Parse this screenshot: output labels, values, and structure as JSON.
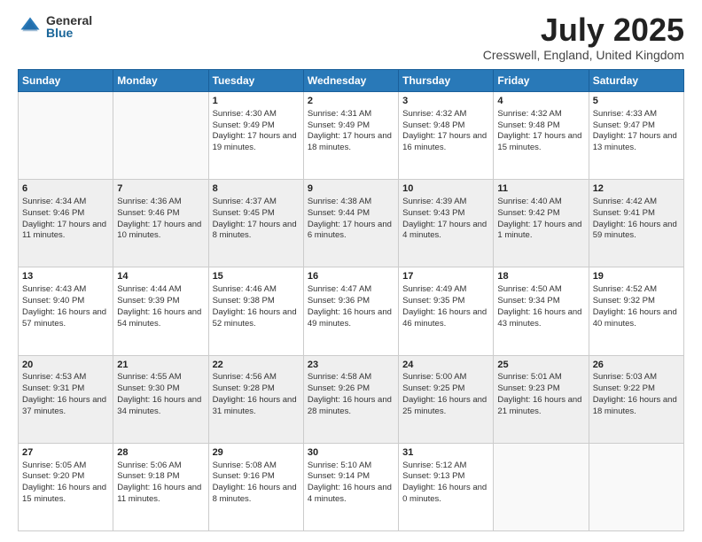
{
  "header": {
    "logo_general": "General",
    "logo_blue": "Blue",
    "title": "July 2025",
    "location": "Cresswell, England, United Kingdom"
  },
  "weekdays": [
    "Sunday",
    "Monday",
    "Tuesday",
    "Wednesday",
    "Thursday",
    "Friday",
    "Saturday"
  ],
  "weeks": [
    [
      {
        "day": "",
        "info": ""
      },
      {
        "day": "",
        "info": ""
      },
      {
        "day": "1",
        "info": "Sunrise: 4:30 AM\nSunset: 9:49 PM\nDaylight: 17 hours and 19 minutes."
      },
      {
        "day": "2",
        "info": "Sunrise: 4:31 AM\nSunset: 9:49 PM\nDaylight: 17 hours and 18 minutes."
      },
      {
        "day": "3",
        "info": "Sunrise: 4:32 AM\nSunset: 9:48 PM\nDaylight: 17 hours and 16 minutes."
      },
      {
        "day": "4",
        "info": "Sunrise: 4:32 AM\nSunset: 9:48 PM\nDaylight: 17 hours and 15 minutes."
      },
      {
        "day": "5",
        "info": "Sunrise: 4:33 AM\nSunset: 9:47 PM\nDaylight: 17 hours and 13 minutes."
      }
    ],
    [
      {
        "day": "6",
        "info": "Sunrise: 4:34 AM\nSunset: 9:46 PM\nDaylight: 17 hours and 11 minutes."
      },
      {
        "day": "7",
        "info": "Sunrise: 4:36 AM\nSunset: 9:46 PM\nDaylight: 17 hours and 10 minutes."
      },
      {
        "day": "8",
        "info": "Sunrise: 4:37 AM\nSunset: 9:45 PM\nDaylight: 17 hours and 8 minutes."
      },
      {
        "day": "9",
        "info": "Sunrise: 4:38 AM\nSunset: 9:44 PM\nDaylight: 17 hours and 6 minutes."
      },
      {
        "day": "10",
        "info": "Sunrise: 4:39 AM\nSunset: 9:43 PM\nDaylight: 17 hours and 4 minutes."
      },
      {
        "day": "11",
        "info": "Sunrise: 4:40 AM\nSunset: 9:42 PM\nDaylight: 17 hours and 1 minute."
      },
      {
        "day": "12",
        "info": "Sunrise: 4:42 AM\nSunset: 9:41 PM\nDaylight: 16 hours and 59 minutes."
      }
    ],
    [
      {
        "day": "13",
        "info": "Sunrise: 4:43 AM\nSunset: 9:40 PM\nDaylight: 16 hours and 57 minutes."
      },
      {
        "day": "14",
        "info": "Sunrise: 4:44 AM\nSunset: 9:39 PM\nDaylight: 16 hours and 54 minutes."
      },
      {
        "day": "15",
        "info": "Sunrise: 4:46 AM\nSunset: 9:38 PM\nDaylight: 16 hours and 52 minutes."
      },
      {
        "day": "16",
        "info": "Sunrise: 4:47 AM\nSunset: 9:36 PM\nDaylight: 16 hours and 49 minutes."
      },
      {
        "day": "17",
        "info": "Sunrise: 4:49 AM\nSunset: 9:35 PM\nDaylight: 16 hours and 46 minutes."
      },
      {
        "day": "18",
        "info": "Sunrise: 4:50 AM\nSunset: 9:34 PM\nDaylight: 16 hours and 43 minutes."
      },
      {
        "day": "19",
        "info": "Sunrise: 4:52 AM\nSunset: 9:32 PM\nDaylight: 16 hours and 40 minutes."
      }
    ],
    [
      {
        "day": "20",
        "info": "Sunrise: 4:53 AM\nSunset: 9:31 PM\nDaylight: 16 hours and 37 minutes."
      },
      {
        "day": "21",
        "info": "Sunrise: 4:55 AM\nSunset: 9:30 PM\nDaylight: 16 hours and 34 minutes."
      },
      {
        "day": "22",
        "info": "Sunrise: 4:56 AM\nSunset: 9:28 PM\nDaylight: 16 hours and 31 minutes."
      },
      {
        "day": "23",
        "info": "Sunrise: 4:58 AM\nSunset: 9:26 PM\nDaylight: 16 hours and 28 minutes."
      },
      {
        "day": "24",
        "info": "Sunrise: 5:00 AM\nSunset: 9:25 PM\nDaylight: 16 hours and 25 minutes."
      },
      {
        "day": "25",
        "info": "Sunrise: 5:01 AM\nSunset: 9:23 PM\nDaylight: 16 hours and 21 minutes."
      },
      {
        "day": "26",
        "info": "Sunrise: 5:03 AM\nSunset: 9:22 PM\nDaylight: 16 hours and 18 minutes."
      }
    ],
    [
      {
        "day": "27",
        "info": "Sunrise: 5:05 AM\nSunset: 9:20 PM\nDaylight: 16 hours and 15 minutes."
      },
      {
        "day": "28",
        "info": "Sunrise: 5:06 AM\nSunset: 9:18 PM\nDaylight: 16 hours and 11 minutes."
      },
      {
        "day": "29",
        "info": "Sunrise: 5:08 AM\nSunset: 9:16 PM\nDaylight: 16 hours and 8 minutes."
      },
      {
        "day": "30",
        "info": "Sunrise: 5:10 AM\nSunset: 9:14 PM\nDaylight: 16 hours and 4 minutes."
      },
      {
        "day": "31",
        "info": "Sunrise: 5:12 AM\nSunset: 9:13 PM\nDaylight: 16 hours and 0 minutes."
      },
      {
        "day": "",
        "info": ""
      },
      {
        "day": "",
        "info": ""
      }
    ]
  ]
}
